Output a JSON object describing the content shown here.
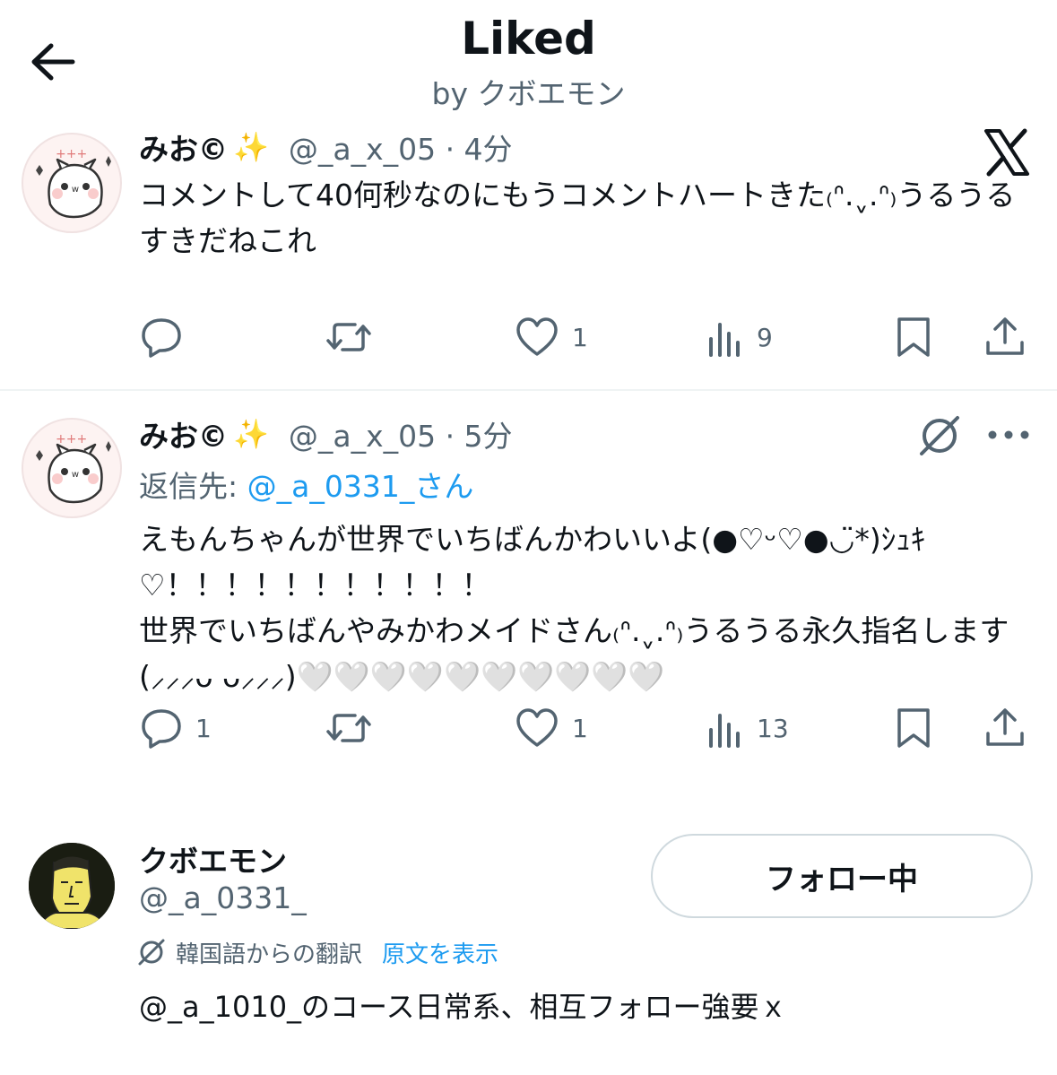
{
  "header": {
    "title": "Liked",
    "subtitle": "by クボエモン"
  },
  "tweets": [
    {
      "name": "みお©︎",
      "handle": "@_a_x_05 · 4分",
      "text": "コメントして40何秒なのにもうコメントハートきた₍ᐢ.ˬ.ᐢ₎うるうる\nすきだねこれ",
      "reply_count": "",
      "retweet_count": "",
      "like_count": "1",
      "view_count": "9"
    },
    {
      "name": "みお©︎",
      "handle": "@_a_x_05 · 5分",
      "reply_prefix": "返信先: ",
      "reply_mention": "@_a_0331_さん",
      "text": "えもんちゃんが世界でいちばんかわいいよ(●♡ᵕ♡●◡̈*)ｼｭｷ♡！！！！！！！！！！！\n世界でいちばんやみかわメイドさん₍ᐢ.ˬ.ᐢ₎うるうる永久指名します(⸝⸝⸝ᴗ ᴗ⸝⸝⸝)🤍🤍🤍🤍🤍🤍🤍🤍🤍🤍",
      "reply_count": "1",
      "retweet_count": "",
      "like_count": "1",
      "view_count": "13"
    }
  ],
  "profile": {
    "name": "クボエモン",
    "handle": "@_a_0331_",
    "follow_label": "フォロー中",
    "translate_label": "韓国語からの翻訳",
    "translate_link": "原文を表示",
    "bio": "@_a_1010_のコース日常系、相互フォロー強要ｘ"
  },
  "colors": {
    "text_primary": "#0f1419",
    "text_secondary": "#536471",
    "accent": "#1d9bf0",
    "divider": "#eff3f4"
  },
  "icons": [
    "back-arrow-icon",
    "x-logo-icon",
    "grok-icon",
    "more-icon",
    "reply-icon",
    "retweet-icon",
    "like-icon",
    "views-icon",
    "bookmark-icon",
    "share-icon",
    "translate-icon"
  ]
}
